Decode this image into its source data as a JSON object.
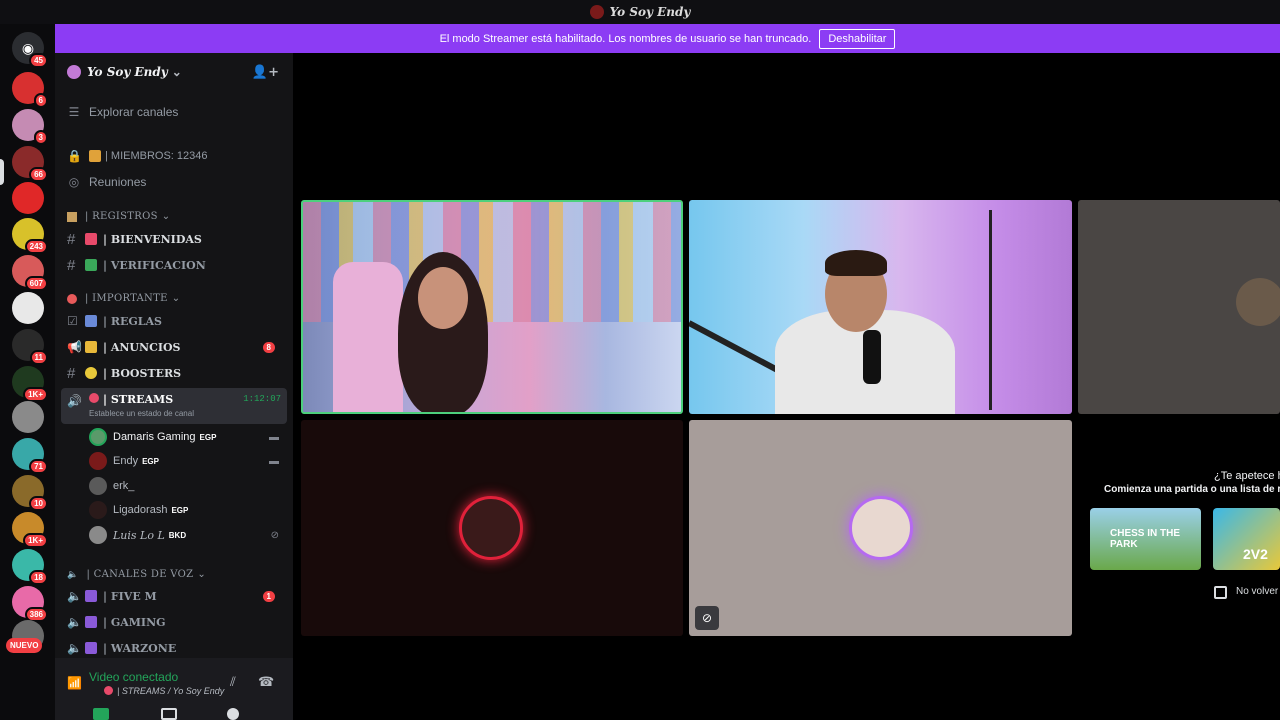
{
  "window": {
    "title": "Yo Soy Endy"
  },
  "banner": {
    "text": "El modo Streamer está habilitado. Los nombres de usuario se han truncado.",
    "button": "Deshabilitar",
    "color": "#8c3cf4"
  },
  "rail": {
    "badges": [
      "45",
      "6",
      "3",
      "66",
      "243",
      "607",
      "11",
      "1K+",
      "71",
      "10",
      "1K+",
      "18",
      "386"
    ],
    "nuevo": "NUEVO"
  },
  "guild": {
    "name": "Yo Soy Endy"
  },
  "nav": {
    "explore": "Explorar canales",
    "members": "| MIEMBROS: 12346",
    "meetings": "Reuniones"
  },
  "categories": {
    "registros": "| REGISTROS",
    "importante": "| IMPORTANTE",
    "voz": "| CANALES DE VOZ"
  },
  "channels": {
    "bienvenidas": "| BIENVENIDAS",
    "verificacion": "| VERIFICACION",
    "reglas": "| REGLAS",
    "anuncios": "| ANUNCIOS",
    "anuncios_badge": "8",
    "boosters": "| BOOSTERS",
    "streams": "| STREAMS",
    "streams_status": "Establece un estado de canal",
    "streams_time": "1:12:07",
    "fivem": "| FIVE M",
    "fivem_badge": "1",
    "gaming": "| GAMING",
    "warzone": "| WARZONE"
  },
  "voice_users": [
    {
      "name": "Damaris Gaming",
      "tag": "EGP"
    },
    {
      "name": "Endy",
      "tag": "EGP"
    },
    {
      "name": "erk_",
      "tag": ""
    },
    {
      "name": "Ligadorash",
      "tag": "EGP"
    },
    {
      "name": "Luis Lo L",
      "tag": "BKD"
    }
  ],
  "voice_panel": {
    "status": "Video conectado",
    "location": "| STREAMS / Yo Soy Endy"
  },
  "activity": {
    "question": "¿Te apetece ha",
    "desc": "Comienza una partida o una lista de re",
    "games": [
      "CHESS IN THE PARK",
      "2V2"
    ],
    "dont_show": "No volver"
  }
}
